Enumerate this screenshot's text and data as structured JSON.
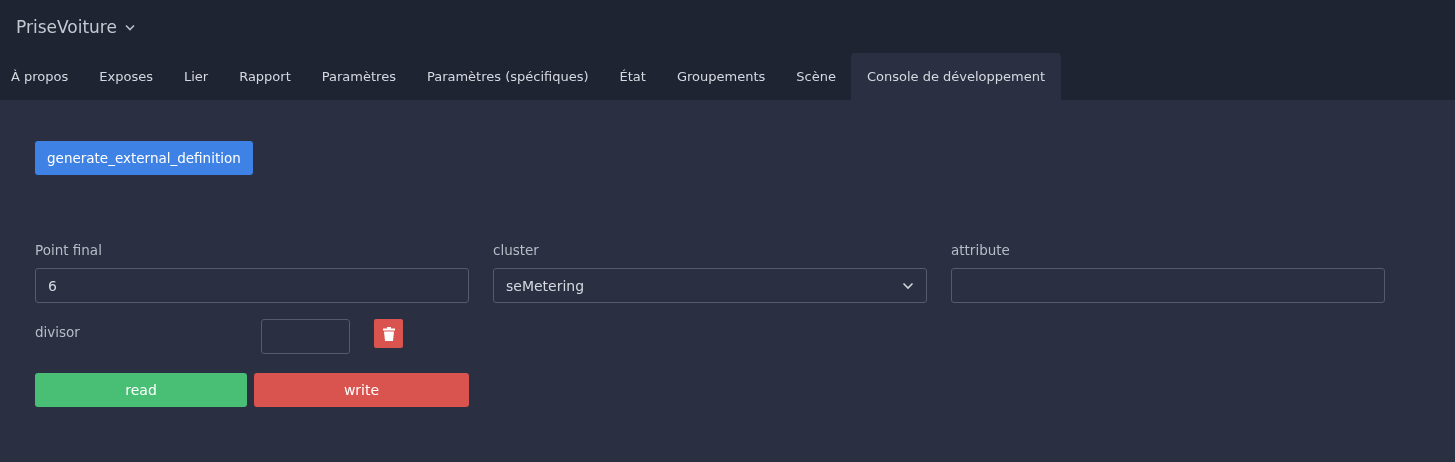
{
  "app": {
    "title": "PriseVoiture"
  },
  "tabs": [
    {
      "label": "À propos",
      "selected": false
    },
    {
      "label": "Exposes",
      "selected": false
    },
    {
      "label": "Lier",
      "selected": false
    },
    {
      "label": "Rapport",
      "selected": false
    },
    {
      "label": "Paramètres",
      "selected": false
    },
    {
      "label": "Paramètres (spécifiques)",
      "selected": false
    },
    {
      "label": "État",
      "selected": false
    },
    {
      "label": "Groupements",
      "selected": false
    },
    {
      "label": "Scène",
      "selected": false
    },
    {
      "label": "Console de développement",
      "selected": true
    }
  ],
  "generate_button": "generate_external_definition",
  "fields": [
    {
      "kind": "input",
      "label": "Point final",
      "value": "6"
    },
    {
      "kind": "select",
      "label": "cluster",
      "value": "seMetering"
    },
    {
      "kind": "input",
      "label": "attribute"
    }
  ],
  "divisor": {
    "label": "divisor"
  },
  "actions": [
    {
      "kind": "read",
      "label": "read"
    },
    {
      "kind": "write",
      "label": "write"
    }
  ]
}
